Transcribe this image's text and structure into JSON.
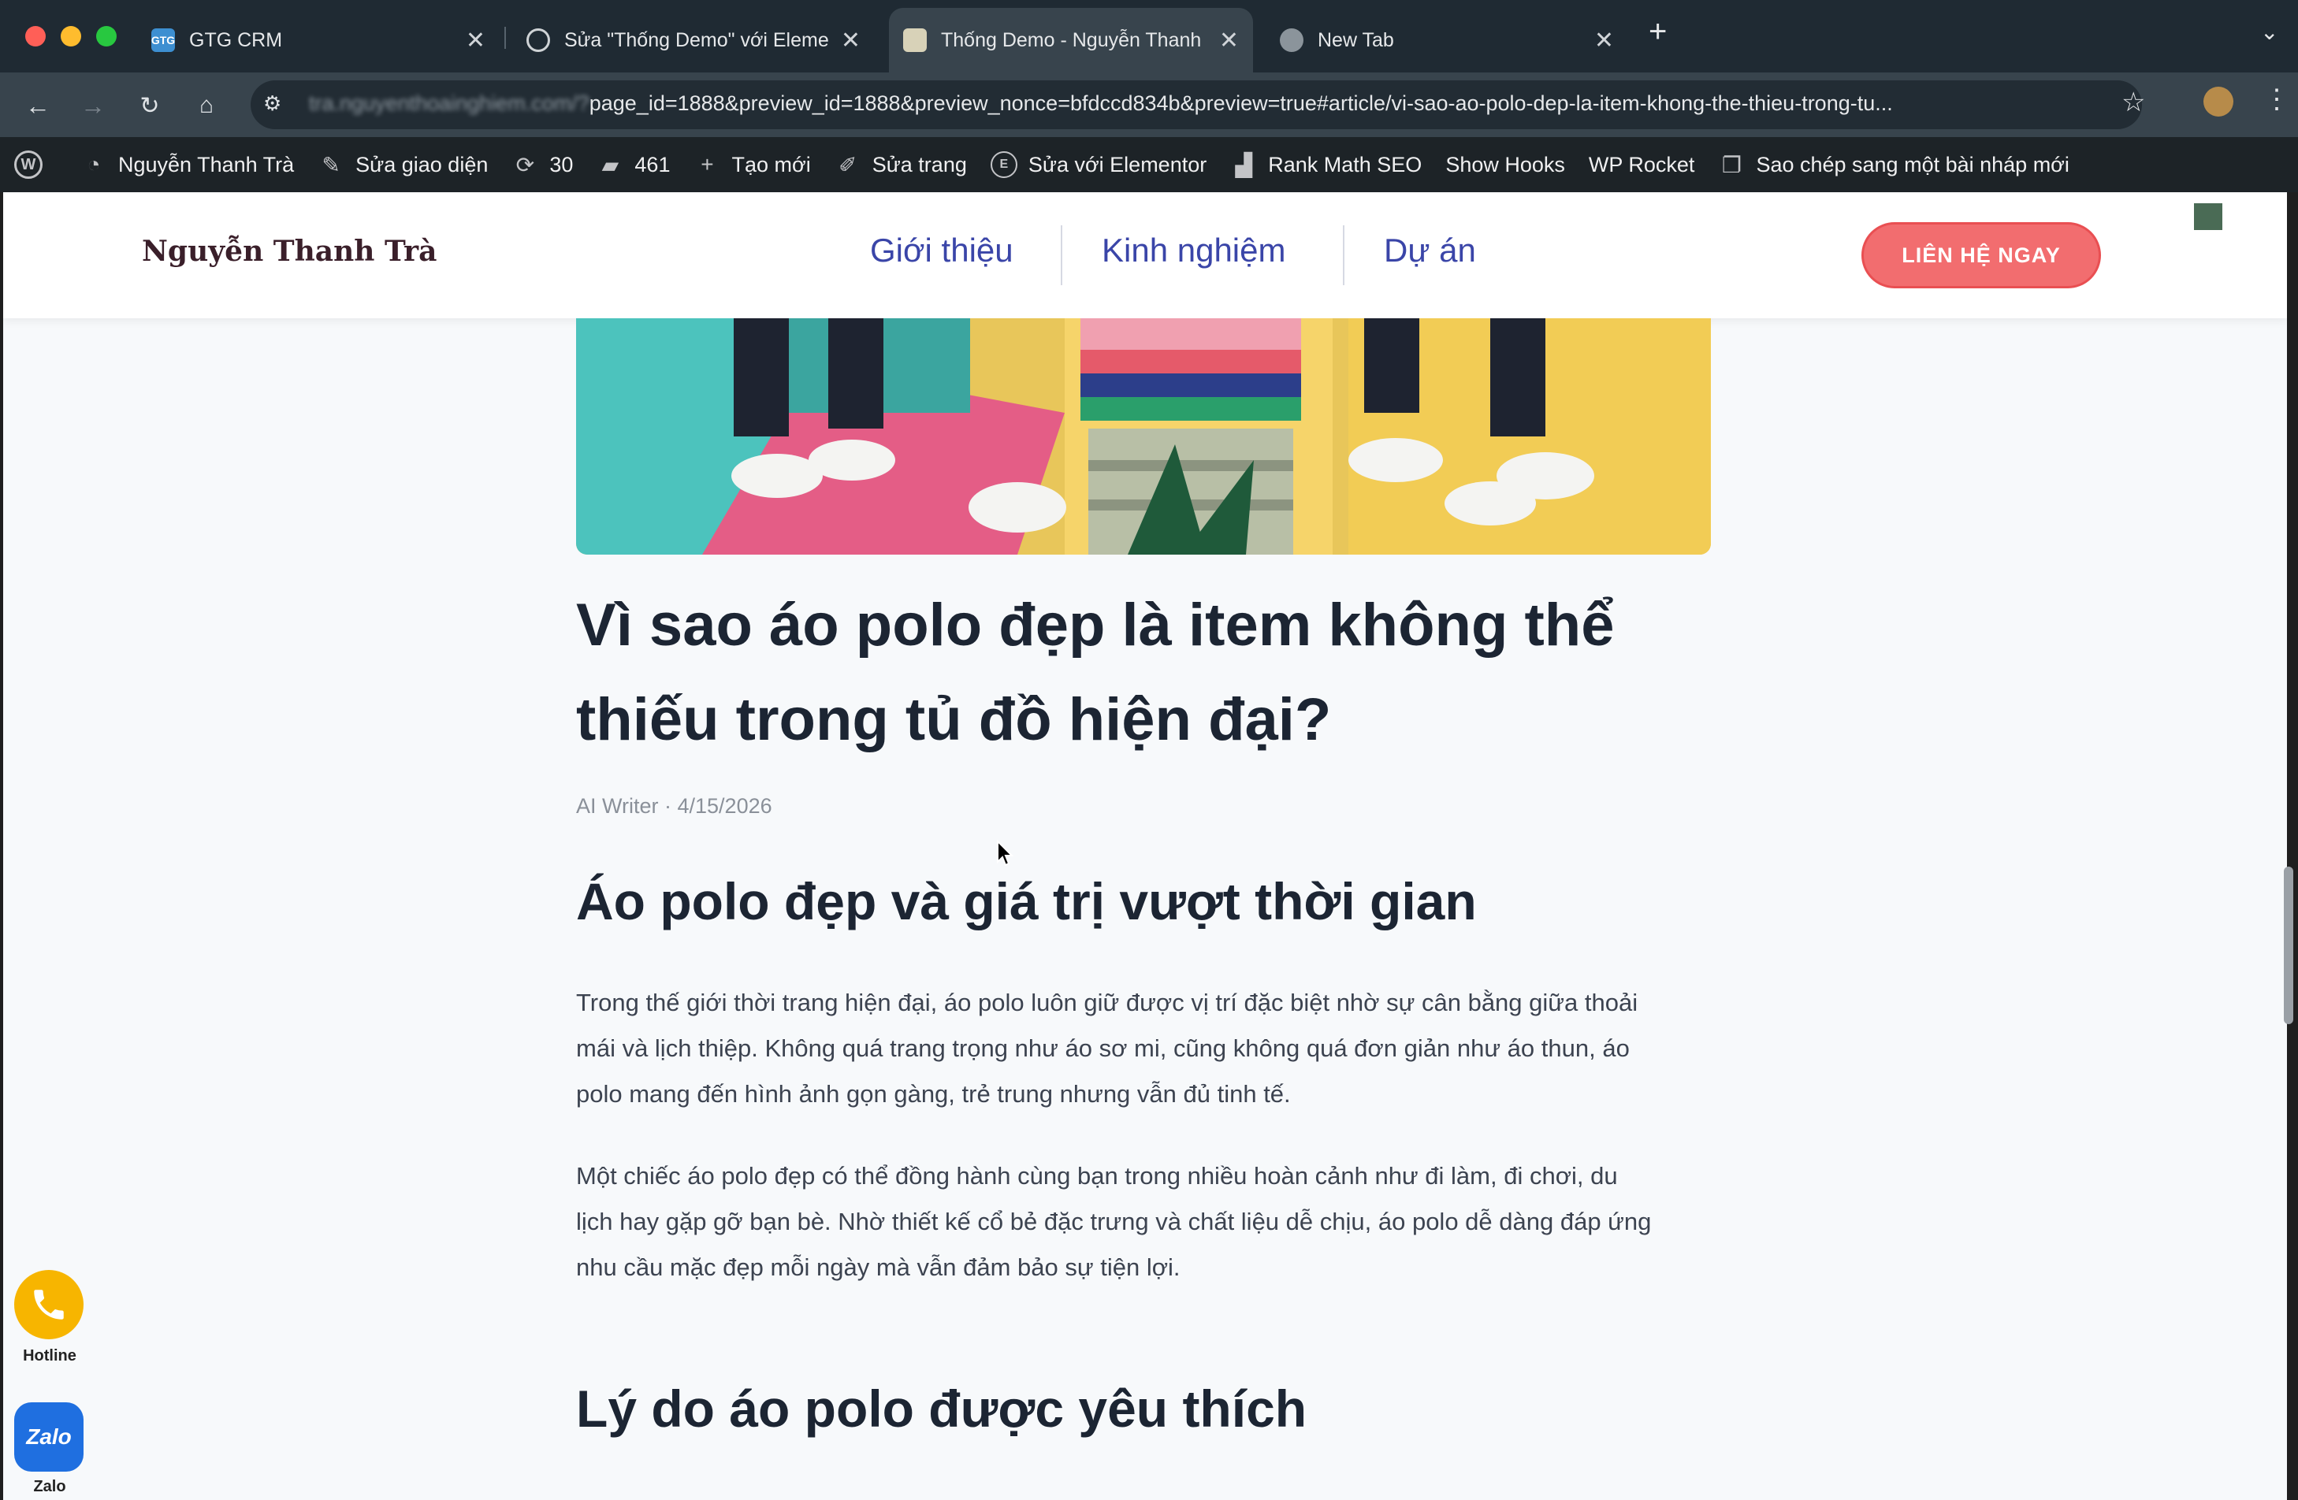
{
  "browser": {
    "tabs": [
      {
        "title": "GTG CRM",
        "favicon": "gtg-crm-favicon",
        "active": false
      },
      {
        "title": "Sửa \"Thống Demo\" với Elementor",
        "favicon": "globe-icon",
        "active": false
      },
      {
        "title": "Thống Demo - Nguyễn Thanh Trà",
        "favicon": "page-favicon",
        "active": true
      },
      {
        "title": "New Tab",
        "favicon": "chrome-icon",
        "active": false
      }
    ],
    "new_tab_label": "+",
    "url_host": "tra.nguyenthoainghiem.com/?",
    "url_path": "page_id=1888&preview_id=1888&preview_nonce=bfdccd834b&preview=true#article/vi-sao-ao-polo-dep-la-item-khong-the-thieu-trong-tu...",
    "close_label": "✕"
  },
  "admin_bar": {
    "items": [
      {
        "label": "",
        "icon": "wordpress-icon"
      },
      {
        "label": "Nguyễn Thanh Trà",
        "icon": "dashboard-icon"
      },
      {
        "label": "Sửa giao diện",
        "icon": "brush-icon"
      },
      {
        "label": "30",
        "icon": "updates-icon"
      },
      {
        "label": "461",
        "icon": "comment-icon"
      },
      {
        "label": "Tạo mới",
        "icon": "plus-icon"
      },
      {
        "label": "Sửa trang",
        "icon": "pencil-icon"
      },
      {
        "label": "Sửa với Elementor",
        "icon": "elementor-icon"
      },
      {
        "label": "Rank Math SEO",
        "icon": "rankmath-icon"
      },
      {
        "label": "Show Hooks",
        "icon": ""
      },
      {
        "label": "WP Rocket",
        "icon": ""
      },
      {
        "label": "Sao chép sang một bài nháp mới",
        "icon": "copy-icon"
      }
    ]
  },
  "site": {
    "logo": "Nguyễn Thanh Trà",
    "nav": [
      "Giới thiệu",
      "Kinh nghiệm",
      "Dự án"
    ],
    "cta": "LIÊN HỆ NGAY"
  },
  "article": {
    "title_line1": "Vì sao áo polo đẹp là item không thể",
    "title_line2": "thiếu trong tủ đồ hiện đại?",
    "meta": "AI Writer · 4/15/2026",
    "section1_heading": "Áo polo đẹp và giá trị vượt thời gian",
    "p1_line1": "Trong thế giới thời trang hiện đại, áo polo luôn giữ được vị trí đặc biệt nhờ sự cân bằng giữa thoải",
    "p1_line2": "mái và lịch thiệp. Không quá trang trọng như áo sơ mi, cũng không quá đơn giản như áo thun, áo",
    "p1_line3": "polo mang đến hình ảnh gọn gàng, trẻ trung nhưng vẫn đủ tinh tế.",
    "p2_line1": "Một chiếc áo polo đẹp có thể đồng hành cùng bạn trong nhiều hoàn cảnh như đi làm, đi chơi, du",
    "p2_line2": "lịch hay gặp gỡ bạn bè. Nhờ thiết kế cổ bẻ đặc trưng và chất liệu dễ chịu, áo polo dễ dàng đáp ứng",
    "p2_line3": "nhu cầu mặc đẹp mỗi ngày mà vẫn đảm bảo sự tiện lợi.",
    "section2_heading": "Lý do áo polo được yêu thích"
  },
  "floating": {
    "hotline_label": "Hotline",
    "zalo_label": "Zalo",
    "zalo_logo_text": "Zalo"
  },
  "colors": {
    "cta": "#f26d6f",
    "nav_link": "#3a45a8",
    "hotline": "#f7b500",
    "zalo": "#1f6fe0"
  }
}
